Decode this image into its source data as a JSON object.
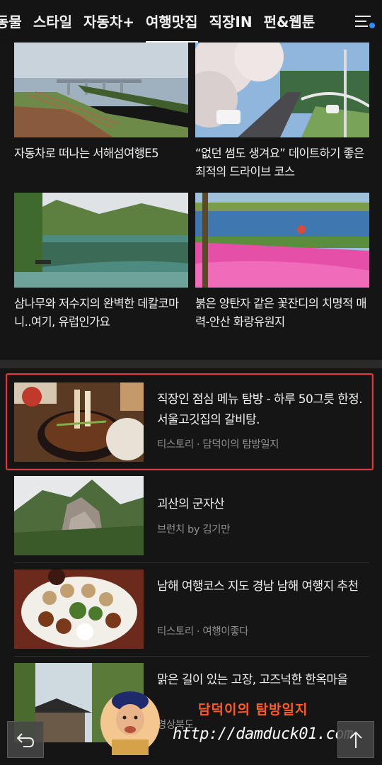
{
  "nav": {
    "tabs": [
      "동물",
      "스타일",
      "자동차+",
      "여행맛집",
      "직장IN",
      "펀&웹툰"
    ],
    "active_index": 3,
    "menu_icon": "menu-notification-icon"
  },
  "grid": [
    {
      "title": "자동차로 떠나는 서해섬여행E5"
    },
    {
      "title": "“없던 썸도 생겨요” 데이트하기 좋은 최적의 드라이브 코스"
    },
    {
      "title": "삼나무와 저수지의 완벽한 데칼코마니..여기, 유럽인가요"
    },
    {
      "title": "붉은 양탄자 같은 꽃잔디의 치명적 매력-안산 화랑유원지"
    }
  ],
  "list": [
    {
      "title": "직장인 점심 메뉴 탐방 - 하루 50그릇 한정. 서울고깃집의 갈비탕.",
      "source": "티스토리 · 담덕이의 탐방일지",
      "highlighted": true
    },
    {
      "title": "괴산의 군자산",
      "source": "브런치 by 김기만"
    },
    {
      "title": "남해 여행코스 지도 경남 남해 여행지 추천",
      "source": "티스토리 · 여행이좋다"
    },
    {
      "title": "맑은 길이 있는 고장, 고즈넉한 한옥마을",
      "source": "경상북도"
    }
  ],
  "overlay": {
    "watermark": "담덕이의 탐방일지",
    "url": "http://damduck01.com",
    "back_icon": "back-arrow-icon",
    "top_icon": "scroll-top-arrow-icon"
  },
  "colors": {
    "background": "#151515",
    "highlight_border": "#e0393c",
    "watermark": "#ff5a2a"
  }
}
